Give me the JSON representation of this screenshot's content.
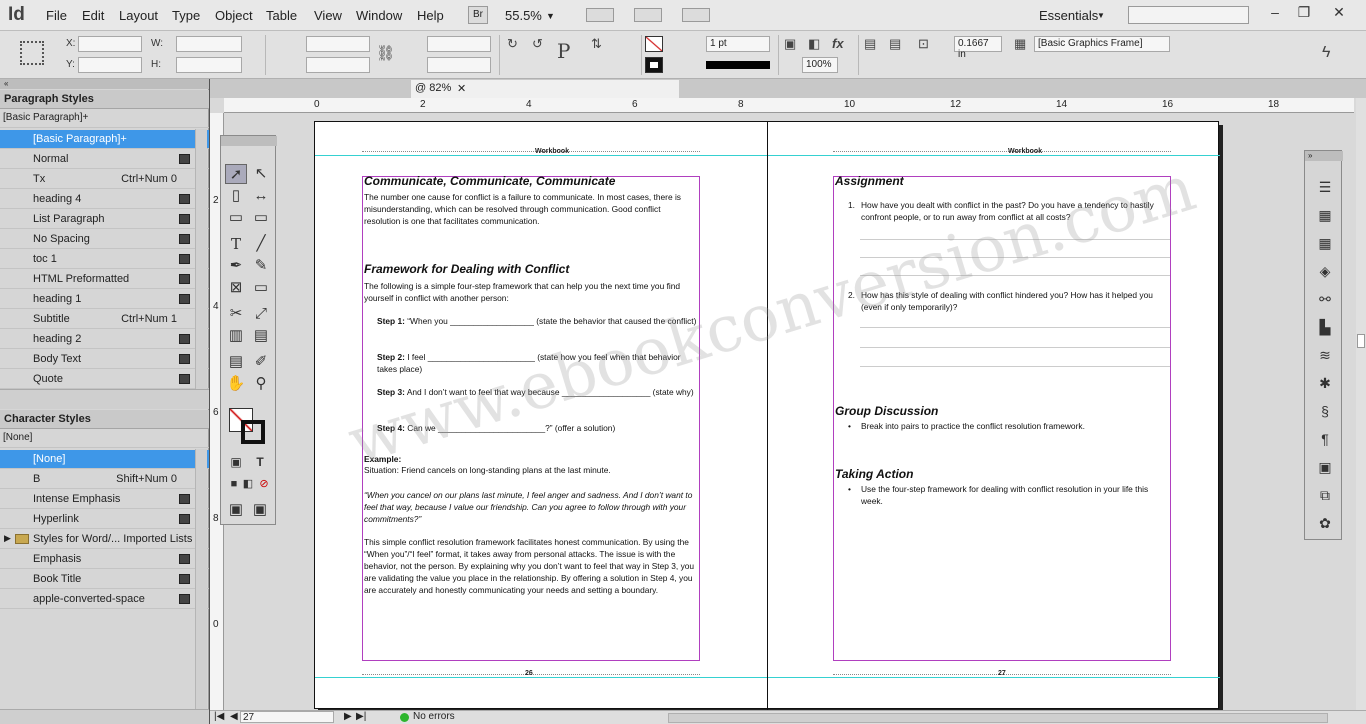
{
  "app": {
    "logo": "Id",
    "menus": [
      "File",
      "Edit",
      "Layout",
      "Type",
      "Object",
      "Table",
      "View",
      "Window",
      "Help"
    ],
    "bridge_label": "Br",
    "zoom": "55.5%",
    "workspace": "Essentials",
    "win_min": "–",
    "win_restore": "❐",
    "win_close": "✕"
  },
  "control": {
    "x_label": "X:",
    "y_label": "Y:",
    "w_label": "W:",
    "h_label": "H:",
    "stroke_weight": "1 pt",
    "offset": "0.1667 in",
    "scale": "100%",
    "frame_style": "[Basic Graphics Frame]"
  },
  "paragraph_panel": {
    "title": "Paragraph Styles",
    "current": "[Basic Paragraph]+",
    "items": [
      {
        "name": "[Basic Paragraph]+",
        "shortcut": "",
        "selected": true
      },
      {
        "name": "Normal",
        "shortcut": ""
      },
      {
        "name": "Tx",
        "shortcut": "Ctrl+Num 0"
      },
      {
        "name": "heading 4",
        "shortcut": ""
      },
      {
        "name": "List Paragraph",
        "shortcut": ""
      },
      {
        "name": "No Spacing",
        "shortcut": ""
      },
      {
        "name": "toc 1",
        "shortcut": ""
      },
      {
        "name": "HTML Preformatted",
        "shortcut": ""
      },
      {
        "name": "heading 1",
        "shortcut": ""
      },
      {
        "name": "Subtitle",
        "shortcut": "Ctrl+Num 1"
      },
      {
        "name": "heading 2",
        "shortcut": ""
      },
      {
        "name": "Body Text",
        "shortcut": ""
      },
      {
        "name": "Quote",
        "shortcut": ""
      }
    ]
  },
  "character_panel": {
    "title": "Character Styles",
    "current": "[None]",
    "items": [
      {
        "name": "[None]",
        "shortcut": "",
        "selected": true
      },
      {
        "name": "B",
        "shortcut": "Shift+Num 0"
      },
      {
        "name": "Intense Emphasis",
        "shortcut": ""
      },
      {
        "name": "Hyperlink",
        "shortcut": ""
      },
      {
        "name": "Styles for Word/... Imported Lists",
        "shortcut": "",
        "folder": true
      },
      {
        "name": "Emphasis",
        "shortcut": ""
      },
      {
        "name": "Book Title",
        "shortcut": ""
      },
      {
        "name": "apple-converted-space",
        "shortcut": ""
      }
    ]
  },
  "document": {
    "tab": "@ 82%",
    "ruler_h": [
      "0",
      "2",
      "4",
      "6",
      "8",
      "10",
      "12",
      "14",
      "16",
      "18"
    ],
    "ruler_v": [
      "2",
      "4",
      "6",
      "8",
      "0"
    ],
    "status_page": "27",
    "status_errors": "No errors",
    "watermark": "www.ebookconversion.com"
  },
  "left_page": {
    "running_head": "Workbook",
    "h1": "Communicate, Communicate, Communicate",
    "p1": "The number one cause for conflict is a failure to communicate. In most cases, there is misunderstanding, which can be resolved through communication. Good conflict resolution is one that facilitates communication.",
    "h2": "Framework for Dealing with Conflict",
    "p2": "The following is a simple four-step framework that can help you the next time you find yourself in conflict with another person:",
    "step1_label": "Step 1:",
    "step1": "“When you __________________ (state the behavior that caused the conflict)",
    "step2_label": "Step 2:",
    "step2": "I feel _______________________ (state how you feel when that behavior takes place)",
    "step3_label": "Step 3:",
    "step3": "And I don’t want to feel that way because ___________________ (state why)",
    "step4_label": "Step 4:",
    "step4": "Can we _______________________?” (offer a solution)",
    "example_label": "Example:",
    "example": "Situation: Friend cancels on long-standing plans at the last minute.",
    "quote": "“When you cancel on our plans last minute, I feel anger and sadness. And I don’t want to feel that way, because I value our friendship. Can you agree to follow through with your commitments?”",
    "p3": "This simple conflict resolution framework facilitates honest communication. By using the “When you”/“I feel” format, it takes away from personal attacks. The issue is with the behavior, not the person. By explaining why you don’t want to feel that way in Step 3, you are validating the value you place in the relationship. By offering a solution in Step 4, you are accurately and honestly communicating your needs and setting a boundary.",
    "folio": "26"
  },
  "right_page": {
    "running_head": "Workbook",
    "h1": "Assignment",
    "q1_num": "1.",
    "q1": "How have you dealt with conflict in the past? Do you have a tendency to hastily confront people, or to run away from conflict at all costs?",
    "q2_num": "2.",
    "q2": "How has this style of dealing with conflict hindered you? How has it helped you (even if only temporarily)?",
    "h2": "Group Discussion",
    "b1": "Break into pairs to practice the conflict resolution framework.",
    "h3": "Taking Action",
    "b2": "Use the four-step framework for dealing with conflict resolution in your life this week.",
    "folio": "27"
  }
}
